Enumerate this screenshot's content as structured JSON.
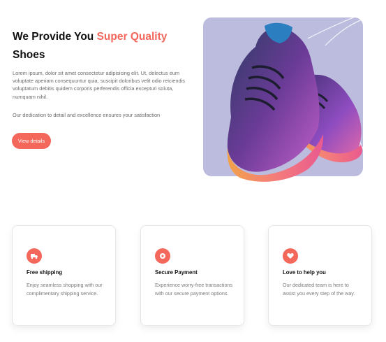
{
  "hero": {
    "title_part1": "We Provide You ",
    "title_accent": "Super Quality",
    "title_part2": "Shoes",
    "description": "Lorem ipsum, dolor sit amet consectetur adipisicing elit. Ut, delectus eum voluptate aperiam consequuntur quia, suscipit doloribus velit odio reiciendis voluptatum debitis quidem corporis perferendis officia excepturi soluta, numquam nihil.",
    "note": "Our dedication to detail and excellence ensures your satisfaction",
    "cta_label": "View details"
  },
  "colors": {
    "accent": "#f4675b",
    "image_background": "#bcbcdf"
  },
  "features": [
    {
      "icon": "shipping-icon",
      "title": "Free shipping",
      "text": "Enjoy seamless shopping with our complimentary shipping service."
    },
    {
      "icon": "payment-icon",
      "title": "Secure Payment",
      "text": "Experience worry-free transactions with our secure payment options."
    },
    {
      "icon": "support-icon",
      "title": "Love to help you",
      "text": "Our dedicated team is here to assist you every step of the way."
    }
  ]
}
